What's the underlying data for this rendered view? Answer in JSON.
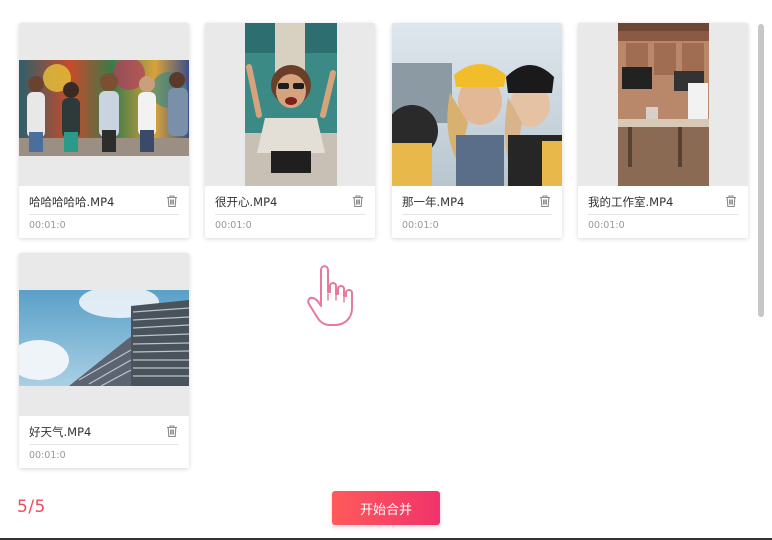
{
  "videos": [
    {
      "name": "哈哈哈哈哈.MP4",
      "duration": "00:01:0",
      "thumbnail": "group-of-friends-graffiti-icon"
    },
    {
      "name": "很开心.MP4",
      "duration": "00:01:0",
      "thumbnail": "woman-sunglasses-icon"
    },
    {
      "name": "那一年.MP4",
      "duration": "00:01:0",
      "thumbnail": "two-women-beanies-icon"
    },
    {
      "name": "我的工作室.MP4",
      "duration": "00:01:0",
      "thumbnail": "office-studio-icon"
    },
    {
      "name": "好天气.MP4",
      "duration": "00:01:0",
      "thumbnail": "building-sky-icon"
    }
  ],
  "footer": {
    "counter": "5/5",
    "merge_label": "开始合并"
  },
  "colors": {
    "accent": "#f04a5e",
    "button_start": "#ff5a5a",
    "button_end": "#f0336b",
    "thumb_bg": "#e9e9e9",
    "hand_cursor": "#e8799a"
  },
  "icons": {
    "delete": "trash-icon",
    "pointer": "hand-pointer-icon"
  }
}
